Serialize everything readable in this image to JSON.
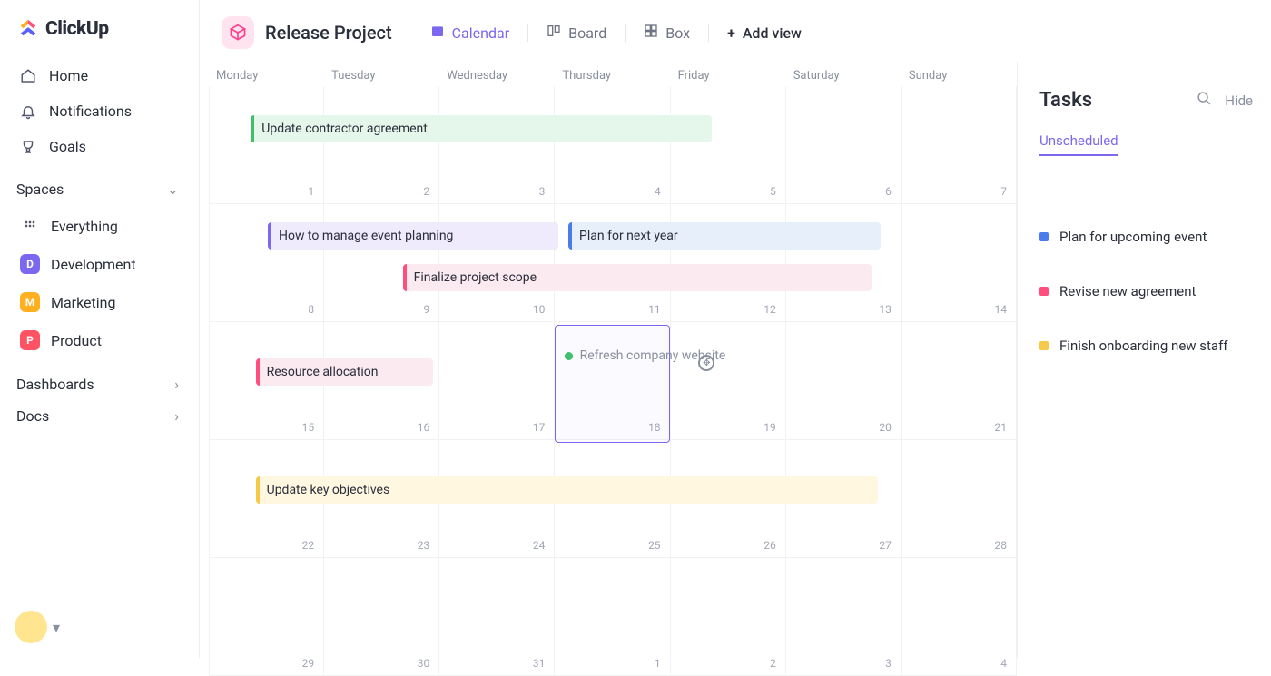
{
  "brand": "ClickUp",
  "sidebar": {
    "nav": [
      {
        "label": "Home"
      },
      {
        "label": "Notifications"
      },
      {
        "label": "Goals"
      }
    ],
    "spaces_header": "Spaces",
    "spaces": [
      {
        "label": "Everything"
      },
      {
        "label": "Development",
        "initial": "D"
      },
      {
        "label": "Marketing",
        "initial": "M"
      },
      {
        "label": "Product",
        "initial": "P"
      }
    ],
    "dashboards": "Dashboards",
    "docs": "Docs"
  },
  "topbar": {
    "project": "Release Project",
    "views": {
      "calendar": "Calendar",
      "board": "Board",
      "box": "Box",
      "add": "Add view"
    }
  },
  "weekdays": [
    "Monday",
    "Tuesday",
    "Wednesday",
    "Thursday",
    "Friday",
    "Saturday",
    "Sunday"
  ],
  "days": {
    "w1": [
      "1",
      "2",
      "3",
      "4",
      "5",
      "6",
      "7"
    ],
    "w2": [
      "8",
      "9",
      "10",
      "11",
      "12",
      "13",
      "14"
    ],
    "w3": [
      "15",
      "16",
      "17",
      "18",
      "19",
      "20",
      "21"
    ],
    "w4": [
      "22",
      "23",
      "24",
      "25",
      "26",
      "27",
      "28"
    ],
    "w5": [
      "29",
      "30",
      "31",
      "1",
      "2",
      "3",
      "4"
    ]
  },
  "events": {
    "update_contractor": "Update contractor agreement",
    "manage_event": "How to manage event planning",
    "plan_next_year": "Plan for next year",
    "finalize_scope": "Finalize project scope",
    "resource_alloc": "Resource allocation",
    "refresh_website": "Refresh company website",
    "update_objectives": "Update key objectives"
  },
  "tasks_panel": {
    "title": "Tasks",
    "hide": "Hide",
    "tab": "Unscheduled",
    "items": [
      {
        "label": "Plan for upcoming event"
      },
      {
        "label": "Revise new agreement"
      },
      {
        "label": "Finish onboarding new staff"
      }
    ]
  }
}
